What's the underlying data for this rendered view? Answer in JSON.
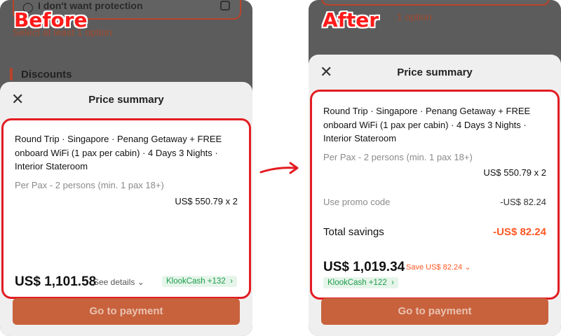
{
  "labels": {
    "before": "Before",
    "after": "After"
  },
  "background": {
    "protection_option": "I don't want protection",
    "select_option": "Select at least 1 option",
    "select_option_partial": "1 option",
    "discounts_heading": "Discounts"
  },
  "sheet": {
    "title": "Price summary",
    "close_icon": "close-icon"
  },
  "product": {
    "name": "Round Trip · Singapore · Penang Getaway + FREE onboard WiFi (1 pax per cabin) · 4 Days 3 Nights · Interior Stateroom",
    "per_pax": "Per Pax - 2 persons (min. 1 pax 18+)",
    "unit_price": "US$ 550.79   x 2"
  },
  "before": {
    "total": "US$ 1,101.58",
    "see_details": "See details",
    "klookcash": "KlookCash +132"
  },
  "after": {
    "promo_label": "Use promo code",
    "promo_value": "-US$ 82.24",
    "savings_label": "Total savings",
    "savings_value": "-US$ 82.24",
    "total": "US$ 1,019.34",
    "save_link": "Save US$ 82.24",
    "klookcash": "KlookCash +122"
  },
  "payment_button": "Go to payment",
  "colors": {
    "highlight": "#e31c23",
    "accent": "#ff5722",
    "cash_green": "#1a9c4a"
  }
}
